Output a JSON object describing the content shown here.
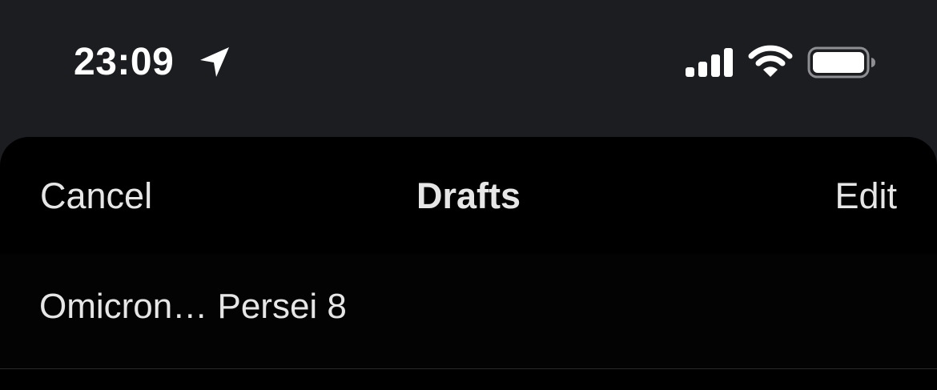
{
  "status_bar": {
    "time": "23:09",
    "icons": [
      "location-arrow-icon",
      "cellular-signal-icon",
      "wifi-icon",
      "battery-icon"
    ]
  },
  "nav": {
    "cancel_label": "Cancel",
    "title": "Drafts",
    "edit_label": "Edit"
  },
  "drafts": [
    {
      "text": "Omicron… Persei 8"
    }
  ],
  "colors": {
    "status_bg": "#1c1d21",
    "sheet_bg": "#000000",
    "text": "#e6e6e6",
    "divider": "#2a2a2d"
  }
}
